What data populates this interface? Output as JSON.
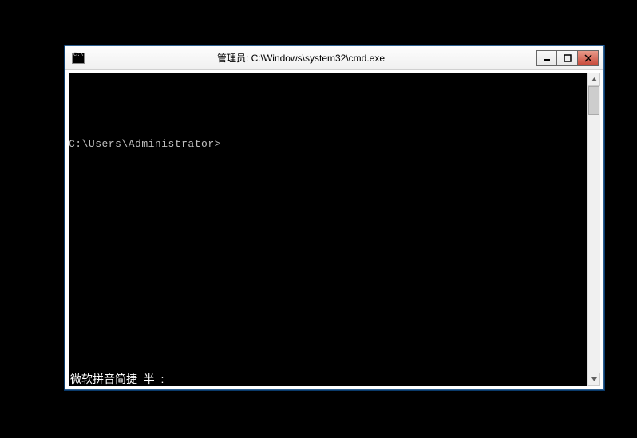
{
  "window": {
    "title": "管理员: C:\\Windows\\system32\\cmd.exe"
  },
  "console": {
    "prompt": "C:\\Users\\Administrator>",
    "ime_status": "微软拼音简捷  半  :"
  },
  "controls": {
    "minimize_name": "minimize",
    "maximize_name": "maximize",
    "close_name": "close"
  }
}
